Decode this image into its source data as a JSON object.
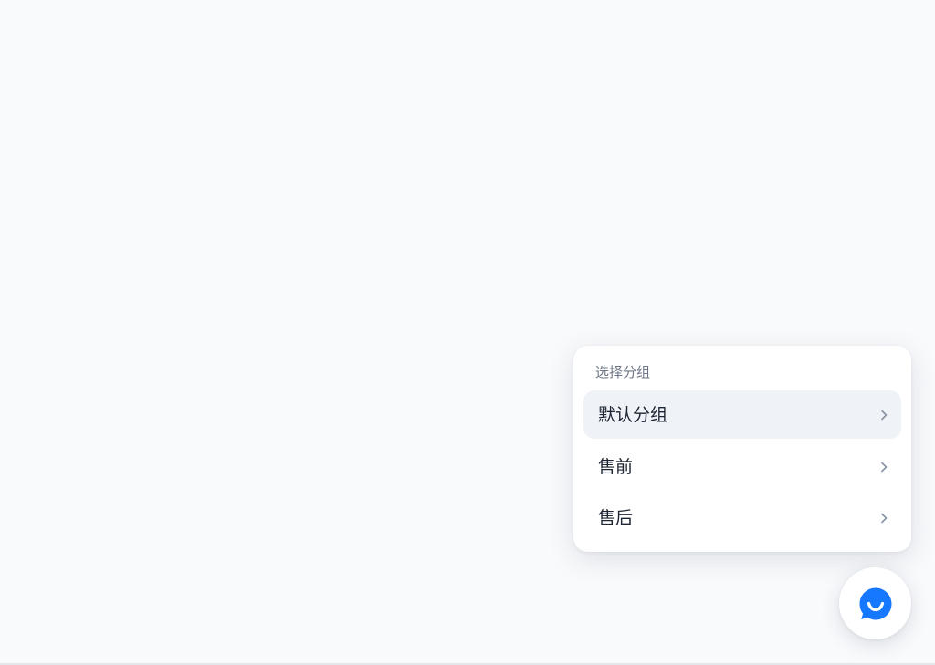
{
  "group_panel": {
    "title": "选择分组",
    "items": [
      {
        "label": "默认分组",
        "active": true
      },
      {
        "label": "售前",
        "active": false
      },
      {
        "label": "售后",
        "active": false
      }
    ]
  },
  "icons": {
    "item_arrow": "chevron-right-icon",
    "launcher": "chat-bubble-smile-icon"
  },
  "colors": {
    "page_background": "#f9fafc",
    "active_item_background": "#eff2f6",
    "launcher_accent": "#1677ff"
  }
}
